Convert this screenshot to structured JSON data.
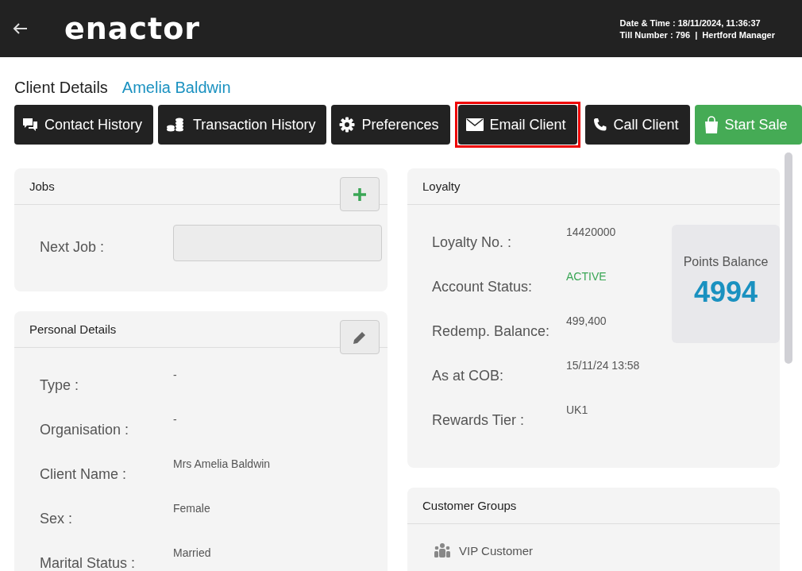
{
  "header": {
    "logo": "enactor",
    "date_time": "Date & Time : 18/11/2024, 11:36:37",
    "till_info": "Till Number : 796  |  Hertford Manager"
  },
  "page": {
    "title": "Client Details",
    "client_name": "Amelia Baldwin"
  },
  "actions": [
    {
      "label": "Contact History",
      "kind": "chat",
      "highlighted": false
    },
    {
      "label": "Transaction History",
      "kind": "coins",
      "highlighted": false
    },
    {
      "label": "Preferences",
      "kind": "gear",
      "highlighted": false
    },
    {
      "label": "Email Client",
      "kind": "mail",
      "highlighted": true
    },
    {
      "label": "Call Client",
      "kind": "phone",
      "highlighted": false
    },
    {
      "label": "Start Sale",
      "kind": "bag",
      "highlighted": false
    }
  ],
  "jobs": {
    "title": "Jobs",
    "next_job_label": "Next Job :"
  },
  "personal_details": {
    "title": "Personal Details",
    "fields": [
      {
        "label": "Type :",
        "value": "-"
      },
      {
        "label": "Organisation :",
        "value": "-"
      },
      {
        "label": "Client Name :",
        "value": "Mrs Amelia Baldwin"
      },
      {
        "label": "Sex :",
        "value": "Female"
      },
      {
        "label": "Marital Status :",
        "value": "Married"
      }
    ]
  },
  "loyalty": {
    "title": "Loyalty",
    "fields": [
      {
        "label": "Loyalty No. :",
        "value": "14420000",
        "kind": "plain"
      },
      {
        "label": "Account Status:",
        "value": "ACTIVE",
        "kind": "status"
      },
      {
        "label": "Redemp. Balance:",
        "value": "499,400",
        "kind": "plain"
      },
      {
        "label": "As at COB:",
        "value": "15/11/24 13:58",
        "kind": "plain"
      },
      {
        "label": "Rewards Tier :",
        "value": "UK1",
        "kind": "plain"
      }
    ],
    "points_label": "Points Balance",
    "points": "4994"
  },
  "customer_groups": {
    "title": "Customer Groups",
    "groups": [
      "VIP Customer"
    ]
  }
}
